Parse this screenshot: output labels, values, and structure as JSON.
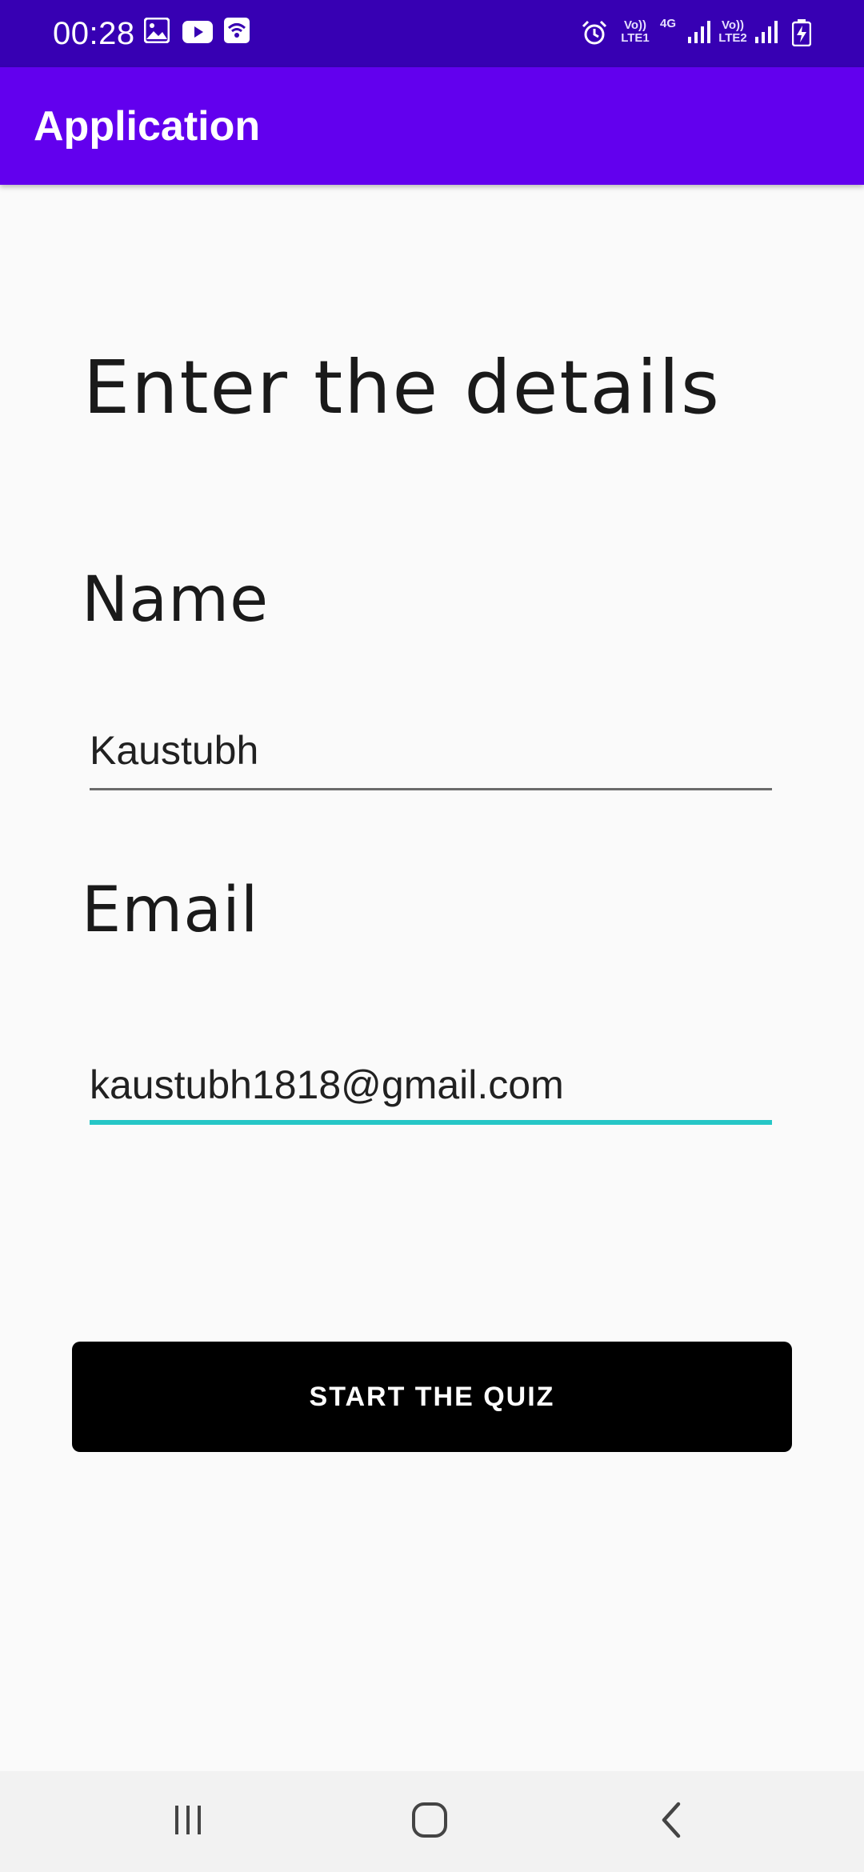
{
  "status_bar": {
    "time": "00:28",
    "left_icons": [
      "gallery-icon",
      "youtube-icon",
      "wifi-calling-icon"
    ],
    "right_icons": [
      "alarm-icon",
      "volte-lte1-icon",
      "4g-icon",
      "signal-icon",
      "volte-lte2-icon",
      "signal-icon",
      "battery-charging-icon"
    ],
    "sim1_text": "Vo))\nLTE1",
    "net_text": "4G",
    "sim2_text": "Vo))\nLTE2"
  },
  "app_bar": {
    "title": "Application",
    "color": "#6200ee"
  },
  "form": {
    "heading": "Enter the details",
    "name_label": "Name",
    "name_value": "Kaustubh",
    "email_label": "Email",
    "email_value": "kaustubh1818@gmail.com",
    "focus_color": "#26c6c6",
    "submit_label": "START THE QUIZ"
  },
  "nav_bar": {
    "buttons": [
      "recent-apps-icon",
      "home-icon",
      "back-icon"
    ]
  }
}
